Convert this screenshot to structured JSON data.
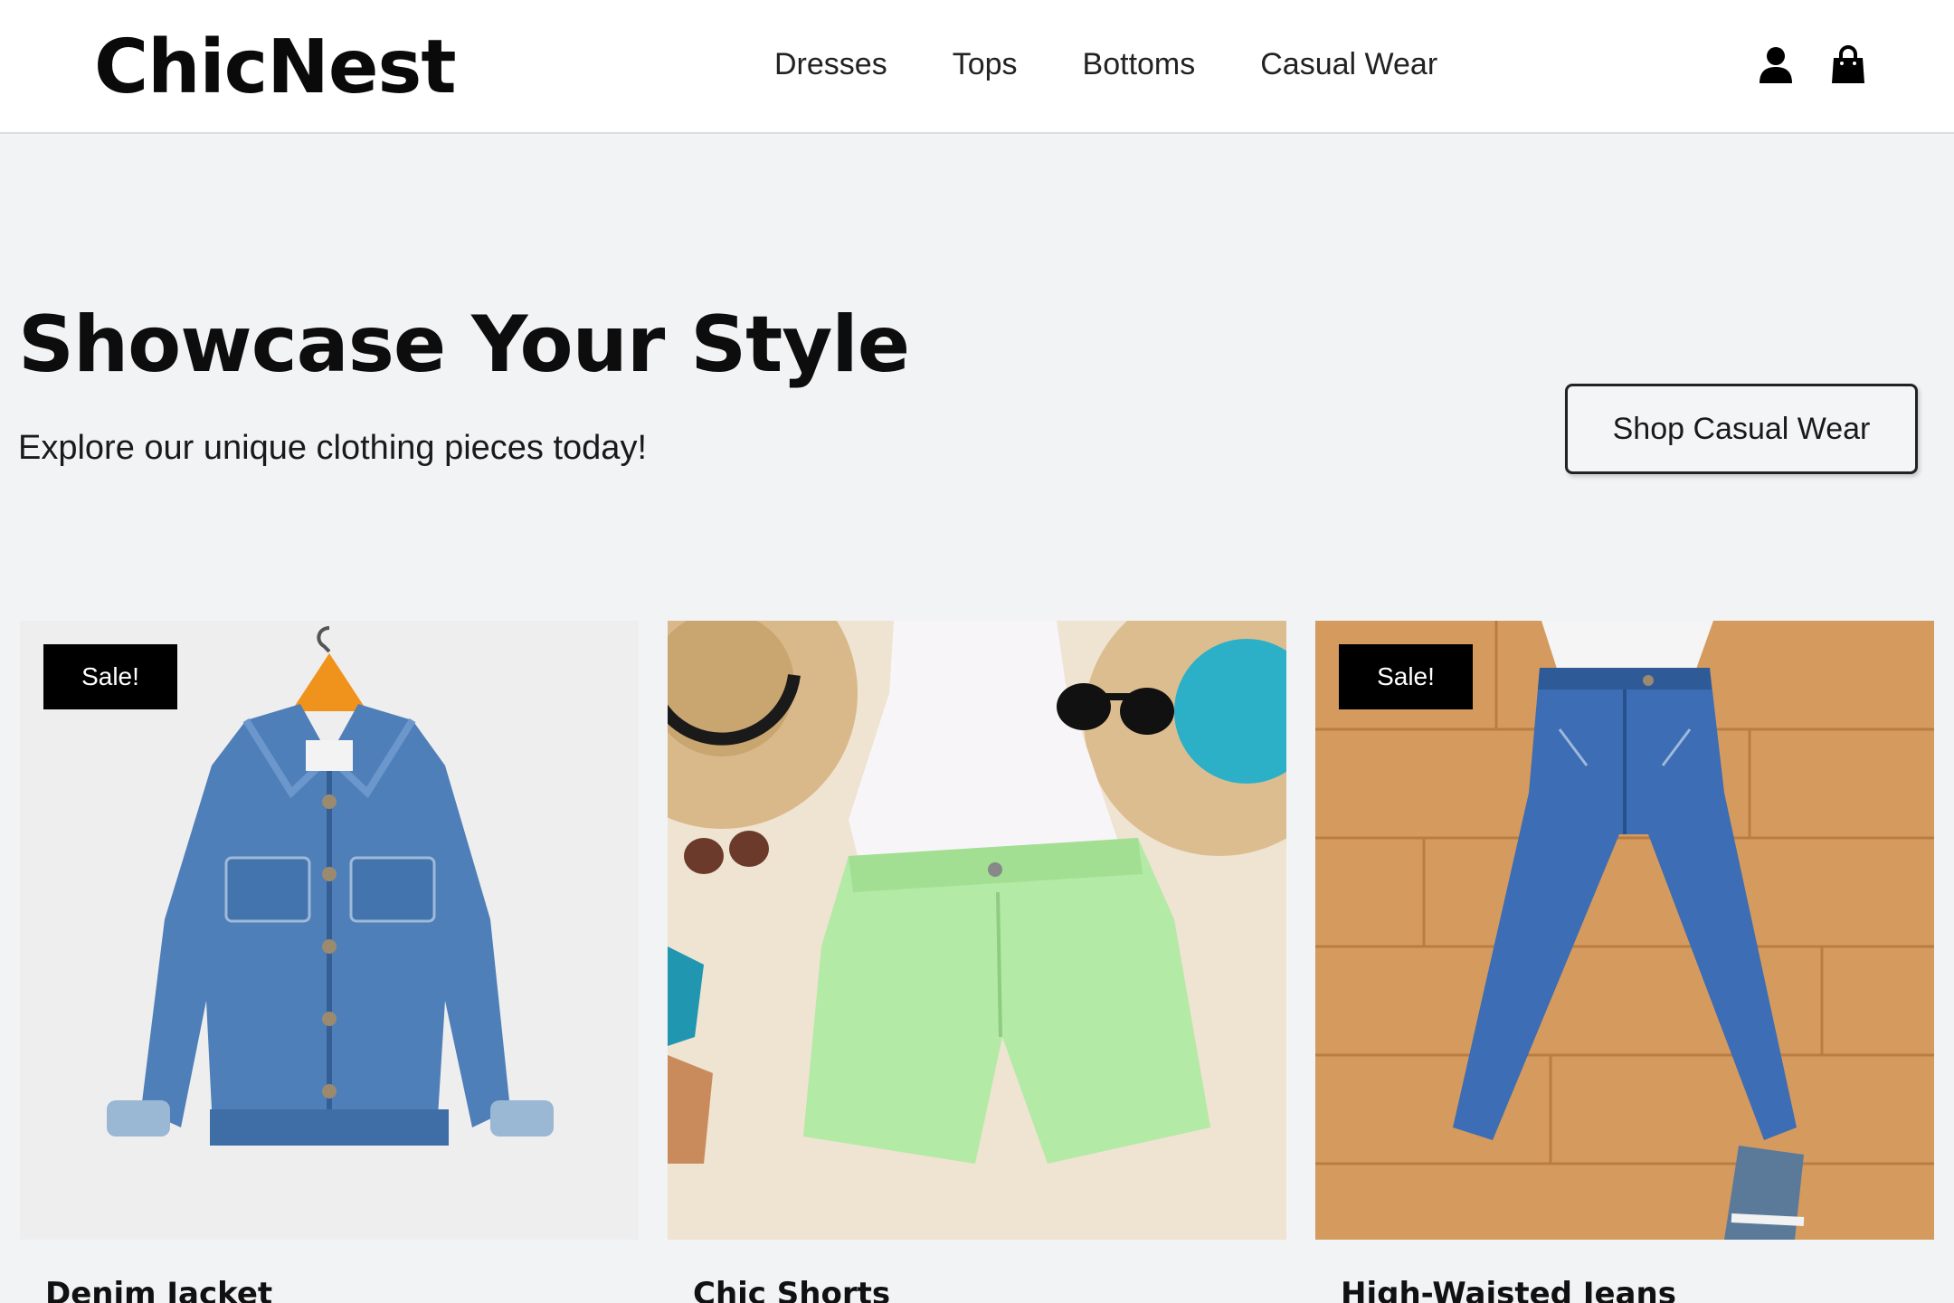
{
  "header": {
    "logo": "ChicNest",
    "nav": [
      "Dresses",
      "Tops",
      "Bottoms",
      "Casual Wear"
    ],
    "icons": [
      "user-icon",
      "shopping-bag-icon"
    ]
  },
  "hero": {
    "title": "Showcase Your Style",
    "subtitle": "Explore our unique clothing pieces today!",
    "cta_label": "Shop Casual Wear"
  },
  "products": [
    {
      "name": "Denim Jacket",
      "badge": "Sale!",
      "image": "denim-jacket-photo"
    },
    {
      "name": "Chic Shorts",
      "badge": "",
      "image": "green-shorts-flatlay-photo"
    },
    {
      "name": "High-Waisted Jeans",
      "badge": "Sale!",
      "image": "jeans-on-wood-floor-photo"
    }
  ],
  "colors": {
    "background": "#f2f3f5",
    "header_bg": "#ffffff",
    "badge_bg": "#000000",
    "text": "#111111"
  }
}
